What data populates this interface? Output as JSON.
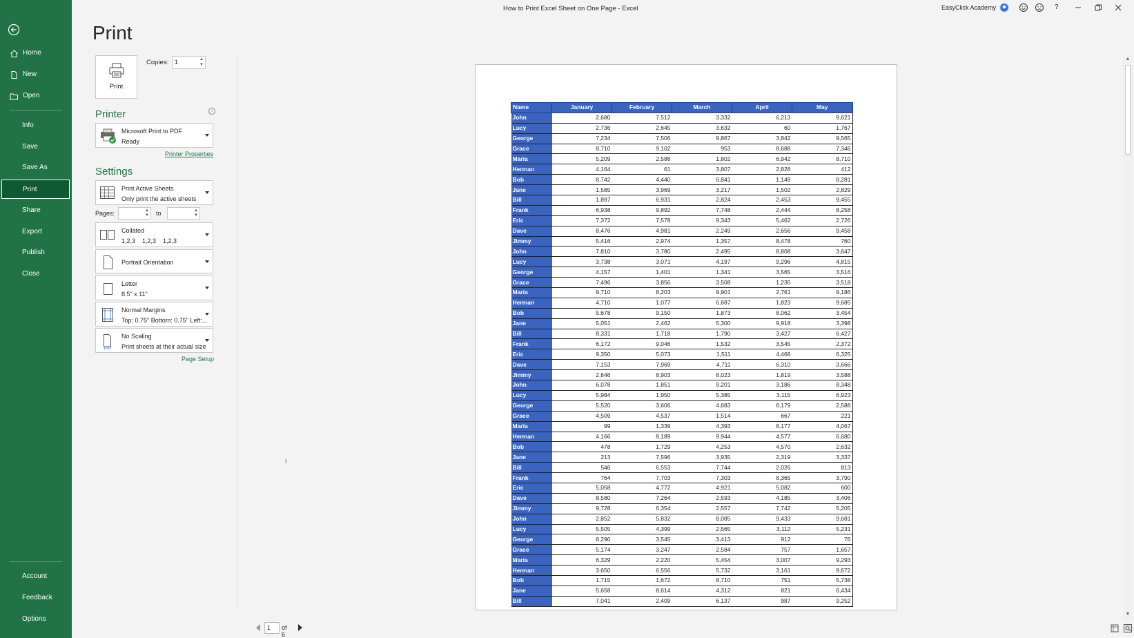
{
  "window": {
    "title": "How to Print Excel Sheet on One Page  -  Excel",
    "account": "EasyClick Academy",
    "controls": [
      "minimize",
      "restore",
      "close"
    ],
    "help": "?"
  },
  "sidebar": {
    "back_icon": "back-arrow-icon",
    "items": [
      {
        "label": "Home",
        "icon": "home-icon"
      },
      {
        "label": "New",
        "icon": "new-document-icon"
      },
      {
        "label": "Open",
        "icon": "open-folder-icon"
      },
      {
        "label": "Info"
      },
      {
        "label": "Save"
      },
      {
        "label": "Save As"
      },
      {
        "label": "Print",
        "active": true
      },
      {
        "label": "Share"
      },
      {
        "label": "Export"
      },
      {
        "label": "Publish"
      },
      {
        "label": "Close"
      }
    ],
    "bottom": [
      {
        "label": "Account"
      },
      {
        "label": "Feedback"
      },
      {
        "label": "Options"
      }
    ]
  },
  "print": {
    "title": "Print",
    "button_label": "Print",
    "copies_label": "Copies:",
    "copies_value": "1"
  },
  "printer": {
    "heading": "Printer",
    "name": "Microsoft Print to PDF",
    "status": "Ready",
    "properties_link": "Printer Properties"
  },
  "settings": {
    "heading": "Settings",
    "sheets": {
      "line1": "Print Active Sheets",
      "line2": "Only print the active sheets"
    },
    "pages_label": "Pages:",
    "pages_to_label": "to",
    "collation": {
      "line1": "Collated",
      "line2": "1,2,3    1,2,3    1,2,3"
    },
    "orientation": {
      "line1": "Portrait Orientation"
    },
    "paper": {
      "line1": "Letter",
      "line2": "8.5\" x 11\""
    },
    "margins": {
      "line1": "Normal Margins",
      "line2": "Top: 0.75\" Bottom: 0.75\" Left:..."
    },
    "scaling": {
      "line1": "No Scaling",
      "line2": "Print sheets at their actual size",
      "icon_text": "100"
    },
    "page_setup_link": "Page Setup"
  },
  "preview": {
    "headers": [
      "Name",
      "January",
      "February",
      "March",
      "April",
      "May"
    ],
    "rows": [
      [
        "John",
        "2,680",
        "7,512",
        "3,332",
        "6,213",
        "9,621"
      ],
      [
        "Lucy",
        "2,736",
        "2,645",
        "3,632",
        "60",
        "1,767"
      ],
      [
        "George",
        "7,234",
        "7,506",
        "9,867",
        "3,842",
        "9,565"
      ],
      [
        "Grace",
        "8,710",
        "9,102",
        "953",
        "8,688",
        "7,346"
      ],
      [
        "Maria",
        "5,209",
        "2,588",
        "1,802",
        "6,942",
        "8,710"
      ],
      [
        "Herman",
        "4,164",
        "61",
        "3,807",
        "2,828",
        "412"
      ],
      [
        "Bob",
        "8,742",
        "4,440",
        "6,841",
        "1,149",
        "8,281"
      ],
      [
        "Jane",
        "1,585",
        "3,969",
        "3,217",
        "1,502",
        "2,829"
      ],
      [
        "Bill",
        "1,897",
        "6,931",
        "2,824",
        "2,453",
        "9,455"
      ],
      [
        "Frank",
        "6,938",
        "9,892",
        "7,748",
        "2,444",
        "8,258"
      ],
      [
        "Eric",
        "7,372",
        "7,578",
        "9,343",
        "5,462",
        "2,726"
      ],
      [
        "Dave",
        "8,476",
        "4,981",
        "2,249",
        "2,656",
        "9,458"
      ],
      [
        "Jimmy",
        "5,416",
        "2,974",
        "1,357",
        "8,478",
        "760"
      ],
      [
        "John",
        "7,810",
        "3,780",
        "2,495",
        "8,808",
        "3,647"
      ],
      [
        "Lucy",
        "3,738",
        "3,071",
        "4,197",
        "9,296",
        "4,815"
      ],
      [
        "George",
        "4,157",
        "1,401",
        "1,341",
        "3,565",
        "3,516"
      ],
      [
        "Grace",
        "7,496",
        "3,856",
        "3,508",
        "1,235",
        "3,518"
      ],
      [
        "Maria",
        "9,710",
        "8,203",
        "9,901",
        "2,761",
        "9,186"
      ],
      [
        "Herman",
        "4,710",
        "1,077",
        "6,687",
        "1,823",
        "9,685"
      ],
      [
        "Bob",
        "5,678",
        "9,150",
        "1,873",
        "8,062",
        "3,454"
      ],
      [
        "Jane",
        "5,051",
        "2,462",
        "5,300",
        "9,918",
        "3,398"
      ],
      [
        "Bill",
        "8,331",
        "1,718",
        "1,790",
        "3,427",
        "6,427"
      ],
      [
        "Frank",
        "6,172",
        "9,046",
        "1,532",
        "3,545",
        "2,372"
      ],
      [
        "Eric",
        "9,350",
        "5,073",
        "1,511",
        "4,468",
        "6,325"
      ],
      [
        "Dave",
        "7,153",
        "7,969",
        "4,711",
        "6,310",
        "3,666"
      ],
      [
        "Jimmy",
        "2,646",
        "8,903",
        "8,023",
        "1,819",
        "3,588"
      ],
      [
        "John",
        "6,078",
        "1,851",
        "9,201",
        "3,186",
        "8,348"
      ],
      [
        "Lucy",
        "5,984",
        "1,950",
        "5,385",
        "3,115",
        "6,923"
      ],
      [
        "George",
        "5,520",
        "3,606",
        "4,683",
        "6,179",
        "2,588"
      ],
      [
        "Grace",
        "4,509",
        "4,537",
        "1,514",
        "667",
        "221"
      ],
      [
        "Maria",
        "99",
        "1,339",
        "4,393",
        "8,177",
        "4,067"
      ],
      [
        "Herman",
        "4,166",
        "8,189",
        "9,944",
        "4,577",
        "6,680"
      ],
      [
        "Bob",
        "478",
        "1,729",
        "4,253",
        "4,570",
        "2,632"
      ],
      [
        "Jane",
        "213",
        "7,596",
        "3,935",
        "2,319",
        "3,337"
      ],
      [
        "Bill",
        "546",
        "6,553",
        "7,744",
        "2,026",
        "813"
      ],
      [
        "Frank",
        "764",
        "7,703",
        "7,303",
        "8,365",
        "3,790"
      ],
      [
        "Eric",
        "5,058",
        "4,772",
        "4,921",
        "5,082",
        "600"
      ],
      [
        "Dave",
        "8,580",
        "7,264",
        "2,593",
        "4,185",
        "3,406"
      ],
      [
        "Jimmy",
        "9,728",
        "6,354",
        "2,557",
        "7,742",
        "5,205"
      ],
      [
        "John",
        "2,852",
        "5,832",
        "8,085",
        "9,433",
        "9,681"
      ],
      [
        "Lucy",
        "5,505",
        "4,399",
        "2,565",
        "3,112",
        "5,231"
      ],
      [
        "George",
        "8,290",
        "3,545",
        "3,413",
        "912",
        "76"
      ],
      [
        "Grace",
        "5,174",
        "3,247",
        "2,584",
        "757",
        "1,657"
      ],
      [
        "Maria",
        "6,329",
        "2,220",
        "5,454",
        "3,007",
        "9,293"
      ],
      [
        "Herman",
        "3,650",
        "6,556",
        "5,732",
        "3,161",
        "9,672"
      ],
      [
        "Bob",
        "1,715",
        "1,672",
        "8,710",
        "751",
        "5,738"
      ],
      [
        "Jane",
        "5,658",
        "8,614",
        "4,312",
        "821",
        "6,434"
      ],
      [
        "Bill",
        "7,041",
        "2,409",
        "6,137",
        "987",
        "9,252"
      ]
    ]
  },
  "page_nav": {
    "current": "1",
    "of_label": "of 6"
  },
  "colors": {
    "sidebar": "#217346",
    "accent": "#217346",
    "table_header": "#3a64c0"
  }
}
